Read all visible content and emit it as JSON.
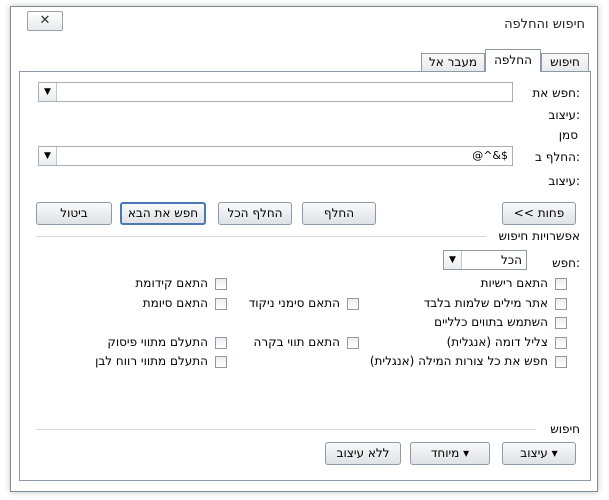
{
  "window": {
    "title": "חיפוש והחלפה",
    "close_glyph": "✕"
  },
  "tabs": [
    {
      "label": "חיפוש",
      "active": false
    },
    {
      "label": "החלפה",
      "active": true
    },
    {
      "label": "מעבר אל",
      "active": false
    }
  ],
  "find": {
    "label": "חפש את:",
    "value": "",
    "format_label": "עיצוב:",
    "format_value": "סמן",
    "dropdown_icon": "dropdown-arrow"
  },
  "replace": {
    "label": "החלף ב:",
    "value": "@^&$",
    "format_label": "עיצוב:",
    "format_value": "",
    "dropdown_icon": "dropdown-arrow"
  },
  "buttons": {
    "less": "<< פחות",
    "replace": "החלף",
    "replace_all": "החלף הכל",
    "find_next": "חפש את הבא",
    "cancel": "ביטול"
  },
  "search_options": {
    "section_title": "אפשרויות חיפוש",
    "search_label": "חפש:",
    "search_value": "הכל",
    "options": {
      "match_case": "התאם רישיות",
      "whole_words": "אתר מילים שלמות בלבד",
      "wildcards": "השתמש בתווים כלליים",
      "sounds_like": "צליל דומה (אנגלית)",
      "all_forms": "חפש את כל צורות המילה (אנגלית)",
      "match_prefix": "התאם קידומת",
      "match_suffix": "התאם סיומת",
      "match_diacritics": "התאם סימני ניקוד",
      "match_kashida": "התאם תווי בקרה",
      "ignore_punct": "התעלם מתווי פיסוק",
      "ignore_space": "התעלם מתווי רווח לבן"
    }
  },
  "replace_section": {
    "title": "חיפוש",
    "format_btn": "עיצוב",
    "special_btn": "מיוחד",
    "no_format_btn": "ללא עיצוב"
  }
}
